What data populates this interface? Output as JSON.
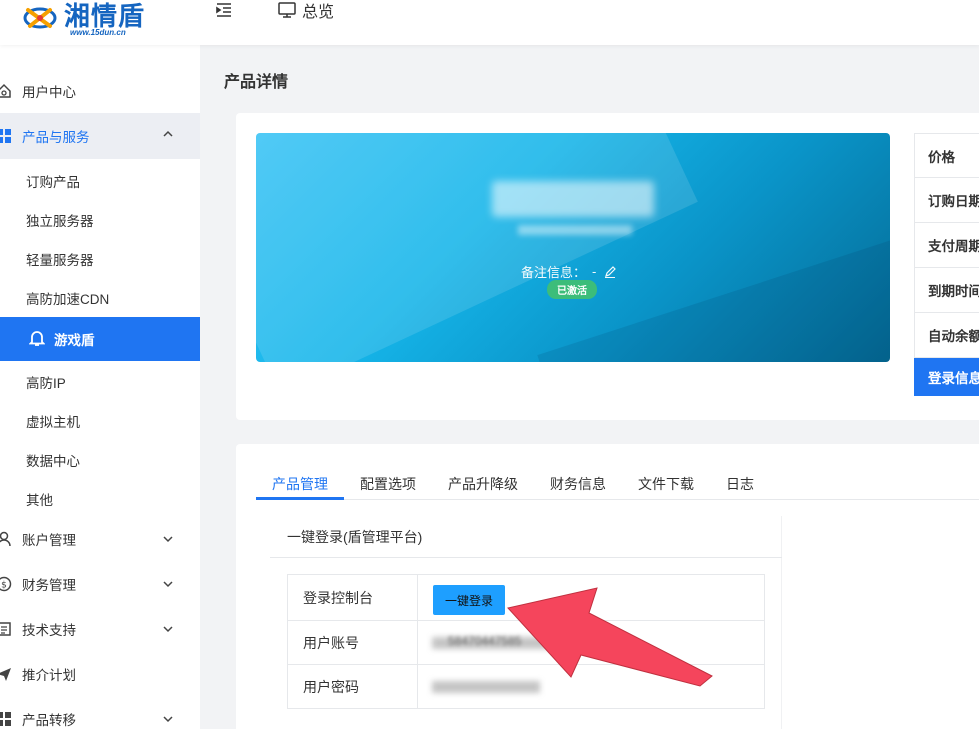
{
  "header": {
    "logo_text": "湘情盾",
    "logo_url": "www.15dun.cn",
    "overview_label": "总览"
  },
  "sidebar": {
    "user_center": "用户中心",
    "products_services": "产品与服务",
    "sub_items": [
      "订购产品",
      "独立服务器",
      "轻量服务器",
      "高防加速CDN"
    ],
    "active_item": "游戏盾",
    "sub_items_after": [
      "高防IP",
      "虚拟主机",
      "数据中心",
      "其他"
    ],
    "account": "账户管理",
    "finance": "财务管理",
    "support": "技术支持",
    "promotion": "推介计划",
    "transfer": "产品转移"
  },
  "main": {
    "page_title": "产品详情",
    "banner": {
      "remark_label": "备注信息：",
      "remark_value": "-",
      "status": "已激活"
    },
    "info_rows": [
      "价格",
      "订购日期",
      "支付周期",
      "到期时间",
      "自动余额",
      "登录信息"
    ],
    "tabs": [
      "产品管理",
      "配置选项",
      "产品升降级",
      "财务信息",
      "文件下载",
      "日志"
    ],
    "panel_title": "一键登录(盾管理平台)",
    "rows": {
      "console_label": "登录控制台",
      "login_button": "一键登录",
      "account_label": "用户账号",
      "account_value": "58470447585",
      "password_label": "用户密码"
    }
  },
  "colors": {
    "primary": "#1f75f2",
    "button": "#1e9fff",
    "badge": "#3cbd7a",
    "arrow": "#f5455c"
  }
}
